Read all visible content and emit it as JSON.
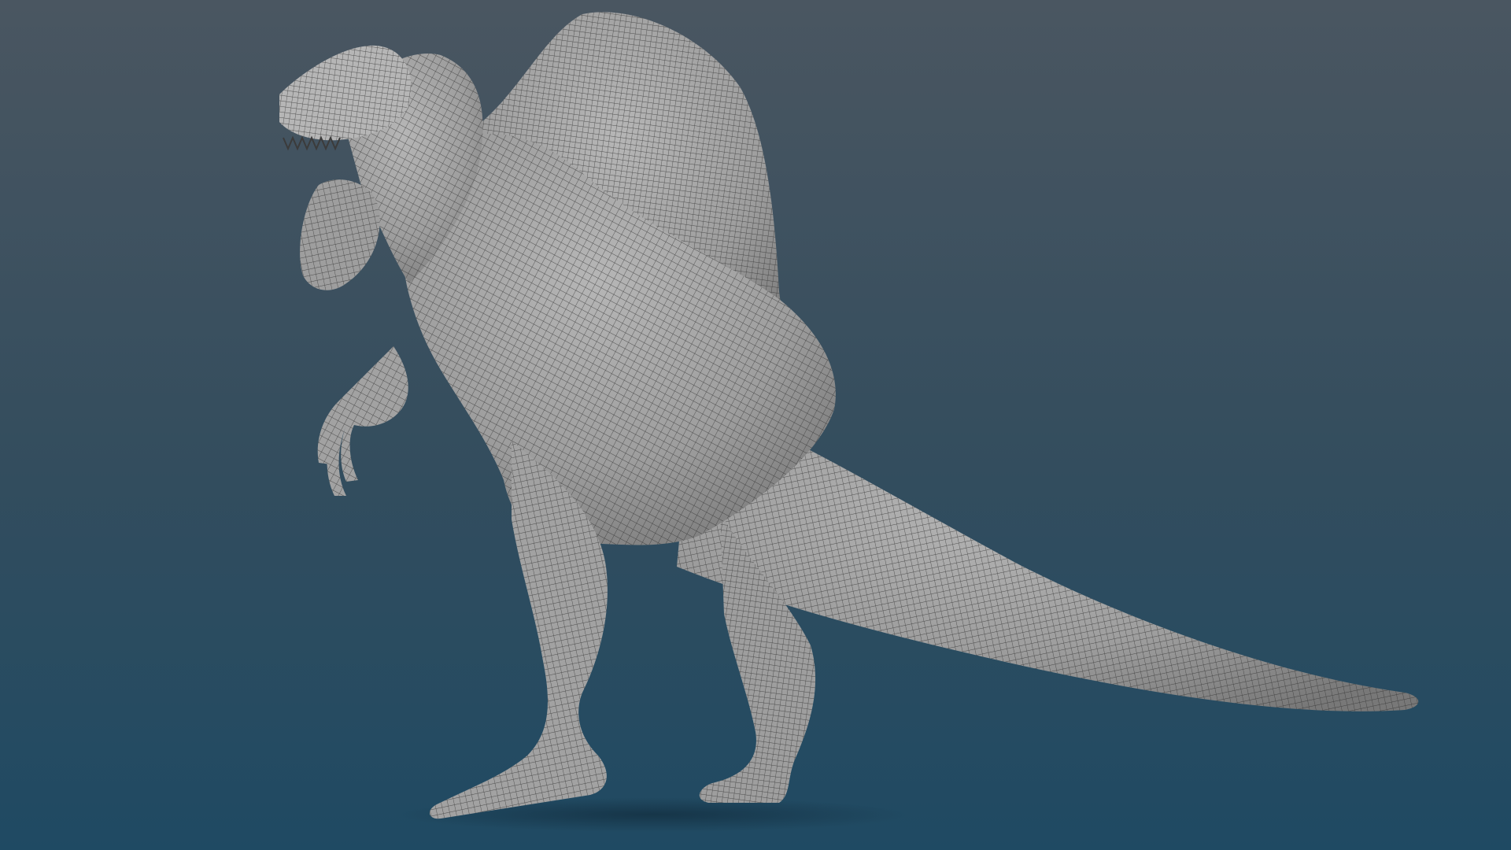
{
  "scene": {
    "background_top_color": "#4a5661",
    "background_mid_color": "#334d5e",
    "background_bottom_color": "#1f4a63",
    "shadow_color": "#0d2433",
    "model_highlight_color": "#b6b6b6",
    "model_fill_color": "#9e9e9e",
    "model_edge_color": "#787878",
    "model_limb_color": "#a2a2a2",
    "wire_color": "#2e2e2e",
    "teeth_color": "#3b3b3b"
  }
}
